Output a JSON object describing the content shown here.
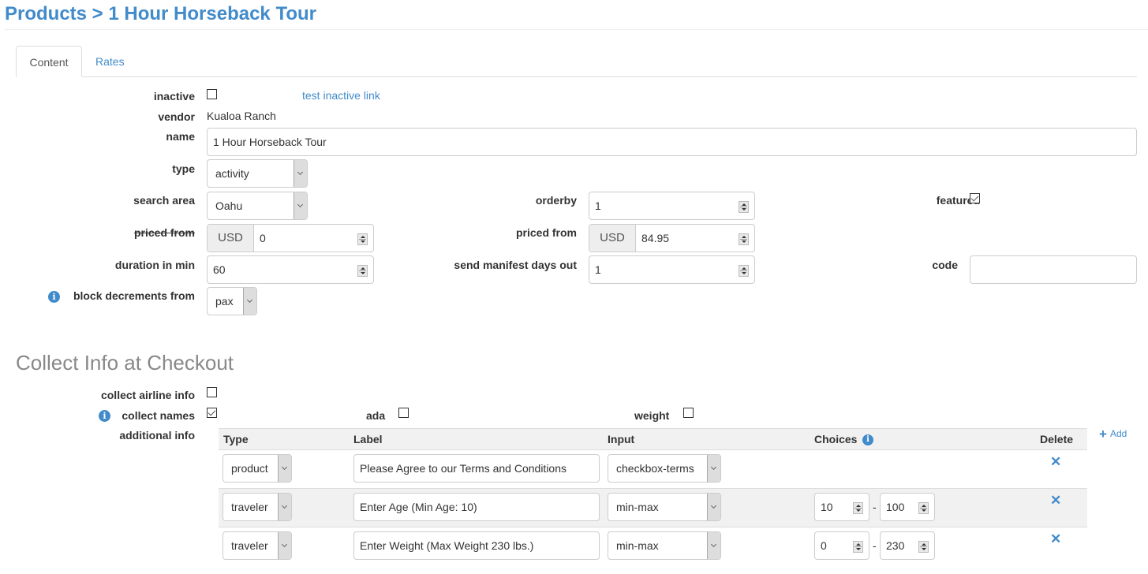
{
  "header": {
    "title": "Products > 1 Hour Horseback Tour"
  },
  "tabs": [
    {
      "label": "Content",
      "active": true
    },
    {
      "label": "Rates",
      "active": false
    }
  ],
  "form": {
    "inactive": {
      "label": "inactive",
      "checked": false,
      "link": "test inactive link"
    },
    "vendor": {
      "label": "vendor",
      "value": "Kualoa Ranch"
    },
    "name": {
      "label": "name",
      "value": "1 Hour Horseback Tour"
    },
    "type": {
      "label": "type",
      "value": "activity"
    },
    "search_area": {
      "label": "search area",
      "value": "Oahu"
    },
    "orderby": {
      "label": "orderby",
      "value": "1"
    },
    "featured": {
      "label": "featured",
      "checked": true
    },
    "priced_from_old": {
      "label": "priced from",
      "currency": "USD",
      "value": "0"
    },
    "priced_from": {
      "label": "priced from",
      "currency": "USD",
      "value": "84.95"
    },
    "duration": {
      "label": "duration in min",
      "value": "60"
    },
    "send_manifest": {
      "label": "send manifest days out",
      "value": "1"
    },
    "code": {
      "label": "code",
      "value": ""
    },
    "block_decrements": {
      "label": "block decrements from",
      "value": "pax",
      "info_icon": "i"
    }
  },
  "checkout": {
    "title": "Collect Info at Checkout",
    "collect_airline": {
      "label": "collect airline info",
      "checked": false
    },
    "collect_names": {
      "label": "collect names",
      "checked": true,
      "info_icon": "i"
    },
    "ada": {
      "label": "ada",
      "checked": false
    },
    "weight": {
      "label": "weight",
      "checked": false
    },
    "additional_info": {
      "label": "additional info",
      "add_label": "Add",
      "columns": {
        "type": "Type",
        "label": "Label",
        "input": "Input",
        "choices": "Choices",
        "delete": "Delete"
      },
      "rows": [
        {
          "type": "product",
          "label": "Please Agree to our Terms and Conditions",
          "input": "checkbox-terms",
          "min": null,
          "max": null
        },
        {
          "type": "traveler",
          "label": "Enter Age (Min Age: 10)",
          "input": "min-max",
          "min": "10",
          "max": "100"
        },
        {
          "type": "traveler",
          "label": "Enter Weight (Max Weight 230 lbs.)",
          "input": "min-max",
          "min": "0",
          "max": "230"
        }
      ],
      "range_separator": "-"
    }
  },
  "colors": {
    "accent": "#428bca",
    "section_title": "#888888"
  }
}
